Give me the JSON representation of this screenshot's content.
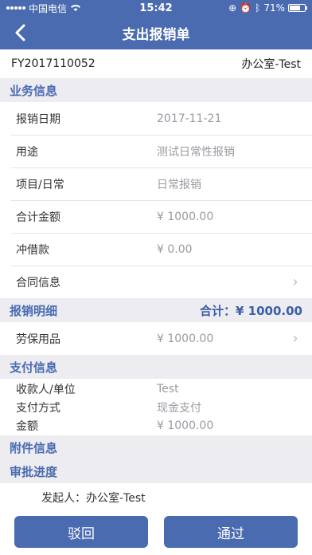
{
  "status": {
    "carrier": "中国电信",
    "time": "15:42",
    "battery": "71%",
    "battery_level": 0.71
  },
  "nav": {
    "title": "支出报销单"
  },
  "doc": {
    "number": "FY2017110052",
    "department": "办公室-Test"
  },
  "business": {
    "header": "业务信息",
    "rows": [
      {
        "label": "报销日期",
        "value": "2017-11-21"
      },
      {
        "label": "用途",
        "value": "测试日常性报销"
      },
      {
        "label": "项目/日常",
        "value": "日常报销"
      },
      {
        "label": "合计金额",
        "value": "¥ 1000.00"
      },
      {
        "label": "冲借款",
        "value": "¥ 0.00"
      },
      {
        "label": "合同信息",
        "value": ""
      }
    ]
  },
  "detail": {
    "header": "报销明细",
    "total": "合计：¥ 1000.00",
    "rows": [
      {
        "label": "劳保用品",
        "value": "¥ 1000.00"
      }
    ]
  },
  "payment": {
    "header": "支付信息",
    "rows": [
      {
        "label": "收款人/单位",
        "value": "Test"
      },
      {
        "label": "支付方式",
        "value": "现金支付"
      },
      {
        "label": "金额",
        "value": "¥ 1000.00"
      }
    ]
  },
  "attachments": {
    "header": "附件信息"
  },
  "approval": {
    "header": "审批进度",
    "initiator": "发起人：办公室-Test"
  },
  "actions": {
    "reject": "驳回",
    "approve": "通过"
  }
}
